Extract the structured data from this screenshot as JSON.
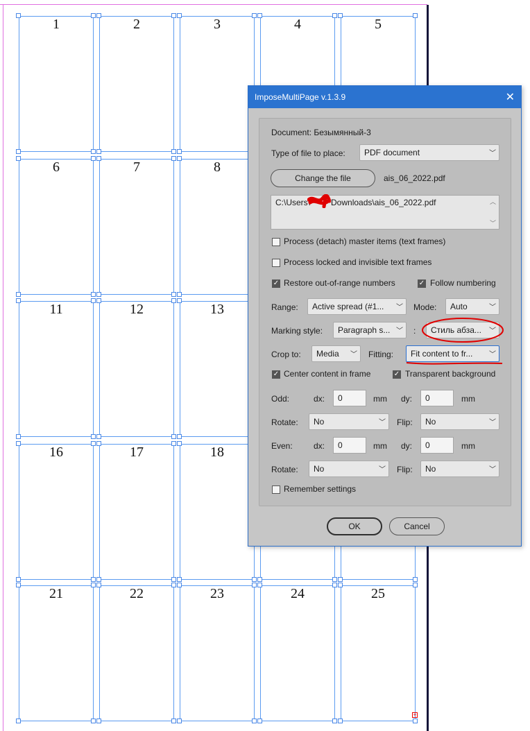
{
  "pages": [
    "1",
    "2",
    "3",
    "4",
    "5",
    "6",
    "7",
    "8",
    "",
    "",
    "11",
    "12",
    "13",
    "",
    "",
    "16",
    "17",
    "18",
    "",
    "",
    "21",
    "22",
    "23",
    "24",
    "25"
  ],
  "dialog": {
    "title": "ImposeMultiPage v.1.3.9",
    "document_label": "Document: Безымянный-3",
    "type_label": "Type of file to place:",
    "type_value": "PDF document",
    "change_file_button": "Change the file",
    "file_name": "ais_06_2022.pdf",
    "path_start": "C:\\Users\\",
    "path_end": "Downloads\\ais_06_2022.pdf",
    "process_master": "Process (detach) master items (text frames)",
    "process_locked": "Process locked and invisible text frames",
    "restore_numbers": "Restore out-of-range numbers",
    "follow_numbering": "Follow numbering",
    "range_label": "Range:",
    "range_value": "Active spread (#1...",
    "mode_label": "Mode:",
    "mode_value": "Auto",
    "marking_label": "Marking style:",
    "marking_value": "Paragraph s...",
    "marking_sep": ":",
    "paragraph_style_value": "Стиль абза...",
    "crop_label": "Crop to:",
    "crop_value": "Media",
    "fitting_label": "Fitting:",
    "fitting_value": "Fit content to fr...",
    "center_content": "Center content in frame",
    "transparent_bg": "Transparent background",
    "odd_label": "Odd:",
    "even_label": "Even:",
    "dx_label": "dx:",
    "dy_label": "dy:",
    "unit": "mm",
    "odd_dx": "0",
    "odd_dy": "0",
    "even_dx": "0",
    "even_dy": "0",
    "rotate_label": "Rotate:",
    "flip_label": "Flip:",
    "odd_rotate": "No",
    "odd_flip": "No",
    "even_rotate": "No",
    "even_flip": "No",
    "remember": "Remember settings",
    "ok": "OK",
    "cancel": "Cancel"
  },
  "checkboxes": {
    "process_master": false,
    "process_locked": false,
    "restore_numbers": true,
    "follow_numbering": true,
    "center_content": true,
    "transparent_bg": true,
    "remember": false
  },
  "icons": {
    "close": "close-icon",
    "chevron": "chevron-down-icon",
    "check": "checkmark-icon"
  },
  "colors": {
    "titlebar": "#2b73d0",
    "frame_border": "#5b9bf0",
    "annotation": "#e00000"
  }
}
